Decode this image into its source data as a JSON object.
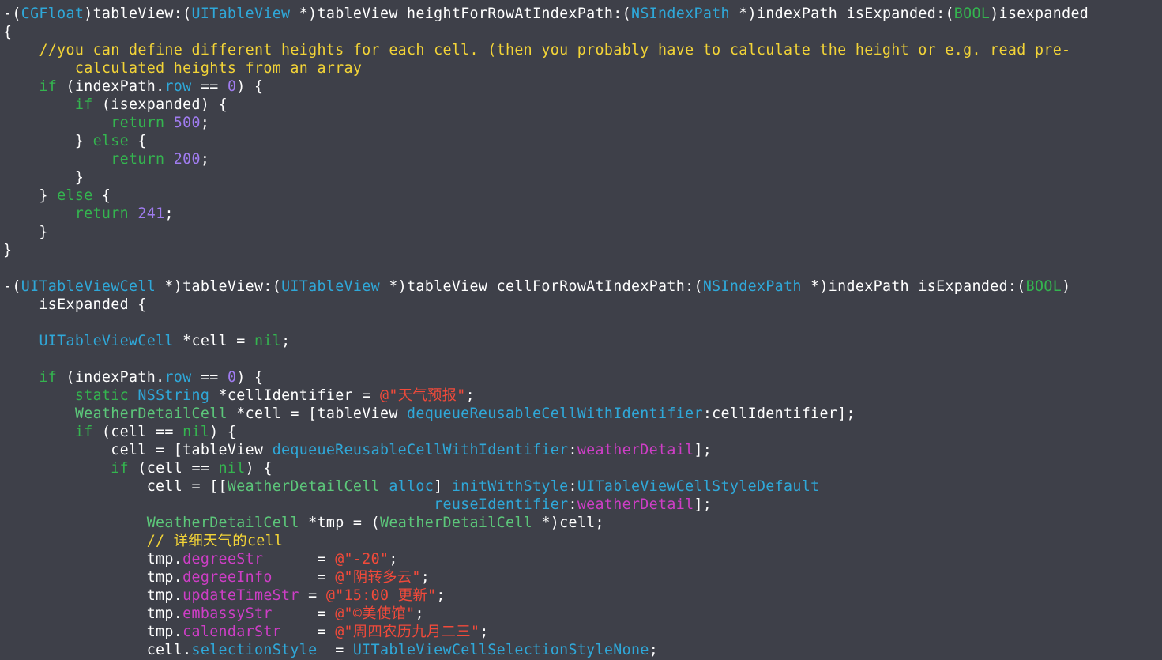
{
  "colors": {
    "background": "#3e4049",
    "plain": "#ffffff",
    "type": "#2fa8d9",
    "keyword": "#34b54f",
    "number": "#a07cf0",
    "comment": "#f3d437",
    "string": "#f24a3a",
    "property": "#ce3ec6",
    "class": "#5cc77a"
  },
  "code_lines": [
    [
      [
        "plain",
        "-("
      ],
      [
        "type",
        "CGFloat"
      ],
      [
        "plain",
        ")tableView:("
      ],
      [
        "type",
        "UITableView"
      ],
      [
        "plain",
        " *)tableView heightForRowAtIndexPath:("
      ],
      [
        "type",
        "NSIndexPath"
      ],
      [
        "plain",
        " *)indexPath isExpanded:("
      ],
      [
        "kw",
        "BOOL"
      ],
      [
        "plain",
        ")isexpanded"
      ]
    ],
    [
      [
        "plain",
        "{"
      ]
    ],
    [
      [
        "plain",
        "    "
      ],
      [
        "cmt",
        "//you can define different heights for each cell. (then you probably have to calculate the height or e.g. read pre-"
      ]
    ],
    [
      [
        "plain",
        "        "
      ],
      [
        "cmt",
        "calculated heights from an array"
      ]
    ],
    [
      [
        "plain",
        "    "
      ],
      [
        "kw",
        "if"
      ],
      [
        "plain",
        " (indexPath."
      ],
      [
        "type",
        "row"
      ],
      [
        "plain",
        " == "
      ],
      [
        "num",
        "0"
      ],
      [
        "plain",
        ") {"
      ]
    ],
    [
      [
        "plain",
        "        "
      ],
      [
        "kw",
        "if"
      ],
      [
        "plain",
        " (isexpanded) {"
      ]
    ],
    [
      [
        "plain",
        "            "
      ],
      [
        "kw",
        "return"
      ],
      [
        "plain",
        " "
      ],
      [
        "num",
        "500"
      ],
      [
        "plain",
        ";"
      ]
    ],
    [
      [
        "plain",
        "        } "
      ],
      [
        "kw",
        "else"
      ],
      [
        "plain",
        " {"
      ]
    ],
    [
      [
        "plain",
        "            "
      ],
      [
        "kw",
        "return"
      ],
      [
        "plain",
        " "
      ],
      [
        "num",
        "200"
      ],
      [
        "plain",
        ";"
      ]
    ],
    [
      [
        "plain",
        "        }"
      ]
    ],
    [
      [
        "plain",
        "    } "
      ],
      [
        "kw",
        "else"
      ],
      [
        "plain",
        " {"
      ]
    ],
    [
      [
        "plain",
        "        "
      ],
      [
        "kw",
        "return"
      ],
      [
        "plain",
        " "
      ],
      [
        "num",
        "241"
      ],
      [
        "plain",
        ";"
      ]
    ],
    [
      [
        "plain",
        "    }"
      ]
    ],
    [
      [
        "plain",
        "}"
      ]
    ],
    [
      [
        "plain",
        ""
      ]
    ],
    [
      [
        "plain",
        "-("
      ],
      [
        "type",
        "UITableViewCell"
      ],
      [
        "plain",
        " *)tableView:("
      ],
      [
        "type",
        "UITableView"
      ],
      [
        "plain",
        " *)tableView cellForRowAtIndexPath:("
      ],
      [
        "type",
        "NSIndexPath"
      ],
      [
        "plain",
        " *)indexPath isExpanded:("
      ],
      [
        "kw",
        "BOOL"
      ],
      [
        "plain",
        ")"
      ]
    ],
    [
      [
        "plain",
        "    isExpanded {"
      ]
    ],
    [
      [
        "plain",
        ""
      ]
    ],
    [
      [
        "plain",
        "    "
      ],
      [
        "type",
        "UITableViewCell"
      ],
      [
        "plain",
        " *cell = "
      ],
      [
        "kw",
        "nil"
      ],
      [
        "plain",
        ";"
      ]
    ],
    [
      [
        "plain",
        ""
      ]
    ],
    [
      [
        "plain",
        "    "
      ],
      [
        "kw",
        "if"
      ],
      [
        "plain",
        " (indexPath."
      ],
      [
        "type",
        "row"
      ],
      [
        "plain",
        " == "
      ],
      [
        "num",
        "0"
      ],
      [
        "plain",
        ") {"
      ]
    ],
    [
      [
        "plain",
        "        "
      ],
      [
        "kw",
        "static"
      ],
      [
        "plain",
        " "
      ],
      [
        "type",
        "NSString"
      ],
      [
        "plain",
        " *cellIdentifier = "
      ],
      [
        "str",
        "@\"天气预报\""
      ],
      [
        "plain",
        ";"
      ]
    ],
    [
      [
        "plain",
        "        "
      ],
      [
        "cls",
        "WeatherDetailCell"
      ],
      [
        "plain",
        " *cell = [tableView "
      ],
      [
        "meth",
        "dequeueReusableCellWithIdentifier"
      ],
      [
        "plain",
        ":cellIdentifier];"
      ]
    ],
    [
      [
        "plain",
        "        "
      ],
      [
        "kw",
        "if"
      ],
      [
        "plain",
        " (cell == "
      ],
      [
        "kw",
        "nil"
      ],
      [
        "plain",
        ") {"
      ]
    ],
    [
      [
        "plain",
        "            cell = [tableView "
      ],
      [
        "meth",
        "dequeueReusableCellWithIdentifier"
      ],
      [
        "plain",
        ":"
      ],
      [
        "prop",
        "weatherDetail"
      ],
      [
        "plain",
        "];"
      ]
    ],
    [
      [
        "plain",
        "            "
      ],
      [
        "kw",
        "if"
      ],
      [
        "plain",
        " (cell == "
      ],
      [
        "kw",
        "nil"
      ],
      [
        "plain",
        ") {"
      ]
    ],
    [
      [
        "plain",
        "                cell = [["
      ],
      [
        "cls",
        "WeatherDetailCell"
      ],
      [
        "plain",
        " "
      ],
      [
        "meth",
        "alloc"
      ],
      [
        "plain",
        "] "
      ],
      [
        "meth",
        "initWithStyle"
      ],
      [
        "plain",
        ":"
      ],
      [
        "type",
        "UITableViewCellStyleDefault"
      ]
    ],
    [
      [
        "plain",
        "                                                "
      ],
      [
        "meth",
        "reuseIdentifier"
      ],
      [
        "plain",
        ":"
      ],
      [
        "prop",
        "weatherDetail"
      ],
      [
        "plain",
        "];"
      ]
    ],
    [
      [
        "plain",
        "                "
      ],
      [
        "cls",
        "WeatherDetailCell"
      ],
      [
        "plain",
        " *tmp = ("
      ],
      [
        "cls",
        "WeatherDetailCell"
      ],
      [
        "plain",
        " *)cell;"
      ]
    ],
    [
      [
        "plain",
        "                "
      ],
      [
        "cmt",
        "// 详细天气的cell"
      ]
    ],
    [
      [
        "plain",
        "                tmp."
      ],
      [
        "prop",
        "degreeStr"
      ],
      [
        "plain",
        "      = "
      ],
      [
        "str",
        "@\"-20\""
      ],
      [
        "plain",
        ";"
      ]
    ],
    [
      [
        "plain",
        "                tmp."
      ],
      [
        "prop",
        "degreeInfo"
      ],
      [
        "plain",
        "     = "
      ],
      [
        "str",
        "@\"阴转多云\""
      ],
      [
        "plain",
        ";"
      ]
    ],
    [
      [
        "plain",
        "                tmp."
      ],
      [
        "prop",
        "updateTimeStr"
      ],
      [
        "plain",
        " = "
      ],
      [
        "str",
        "@\"15:00 更新\""
      ],
      [
        "plain",
        ";"
      ]
    ],
    [
      [
        "plain",
        "                tmp."
      ],
      [
        "prop",
        "embassyStr"
      ],
      [
        "plain",
        "     = "
      ],
      [
        "str",
        "@\"©美使馆\""
      ],
      [
        "plain",
        ";"
      ]
    ],
    [
      [
        "plain",
        "                tmp."
      ],
      [
        "prop",
        "calendarStr"
      ],
      [
        "plain",
        "    = "
      ],
      [
        "str",
        "@\"周四农历九月二三\""
      ],
      [
        "plain",
        ";"
      ]
    ],
    [
      [
        "plain",
        "                cell."
      ],
      [
        "type",
        "selectionStyle"
      ],
      [
        "plain",
        "  = "
      ],
      [
        "type",
        "UITableViewCellSelectionStyleNone"
      ],
      [
        "plain",
        ";"
      ]
    ]
  ]
}
